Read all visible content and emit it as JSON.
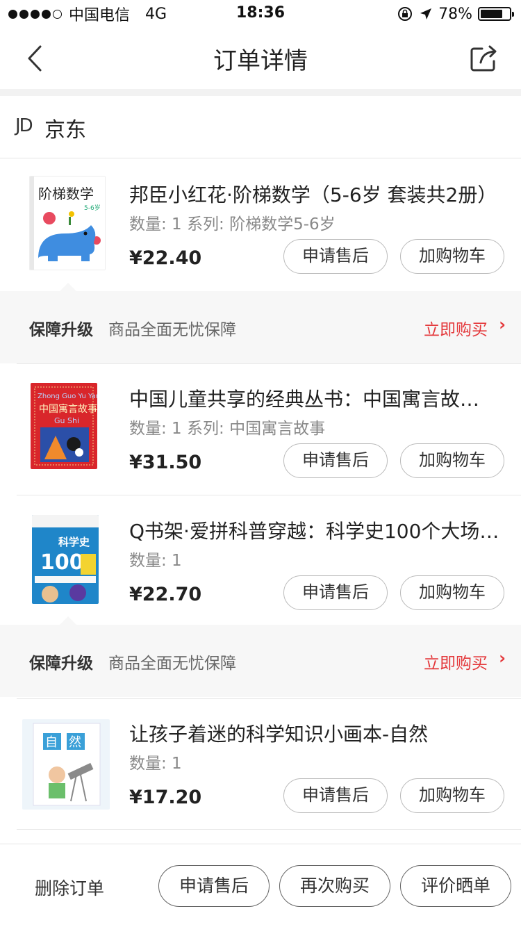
{
  "status_bar": {
    "carrier": "中国电信",
    "network": "4G",
    "time": "18:36",
    "battery": "78%",
    "battery_level": 0.78
  },
  "nav": {
    "title": "订单详情",
    "back_icon": "chevron-left-icon",
    "share_icon": "share-icon"
  },
  "shop": {
    "logo": "JD",
    "name": "京东"
  },
  "products": [
    {
      "title": "邦臣小红花·阶梯数学（5-6岁 套装共2册）",
      "meta": "数量: 1 系列: 阶梯数学5-6岁",
      "price": "¥22.40",
      "after_sale_label": "申请售后",
      "add_cart_label": "加购物车",
      "cover_text": "阶梯数学",
      "cover_sub": "5-6岁"
    },
    {
      "title": "中国儿童共享的经典丛书：中国寓言故…",
      "meta": "数量: 1 系列: 中国寓言故事",
      "price": "¥31.50",
      "after_sale_label": "申请售后",
      "add_cart_label": "加购物车",
      "cover_text": "中国寓言故事",
      "cover_sub": "Gu Shi"
    },
    {
      "title": "Q书架·爱拼科普穿越：科学史100个大场…",
      "meta": "数量: 1",
      "price": "¥22.70",
      "after_sale_label": "申请售后",
      "add_cart_label": "加购物车",
      "cover_text": "科学史",
      "cover_sub": "100"
    },
    {
      "title": "让孩子着迷的科学知识小画本-自然",
      "meta": "数量: 1",
      "price": "¥17.20",
      "after_sale_label": "申请售后",
      "add_cart_label": "加购物车",
      "cover_text": "自然",
      "cover_sub": ""
    }
  ],
  "guarantees": [
    {
      "label": "保障升级",
      "desc": "商品全面无忧保障",
      "action": "立即购买",
      "chevron": "›"
    },
    {
      "label": "保障升级",
      "desc": "商品全面无忧保障",
      "action": "立即购买",
      "chevron": "›"
    }
  ],
  "bottom_bar": {
    "delete_label": "删除订单",
    "after_sale_label": "申请售后",
    "rebuy_label": "再次购买",
    "review_label": "评价晒单"
  },
  "colors": {
    "accent_red": "#e4393c",
    "background_gray": "#f7f7f7"
  }
}
